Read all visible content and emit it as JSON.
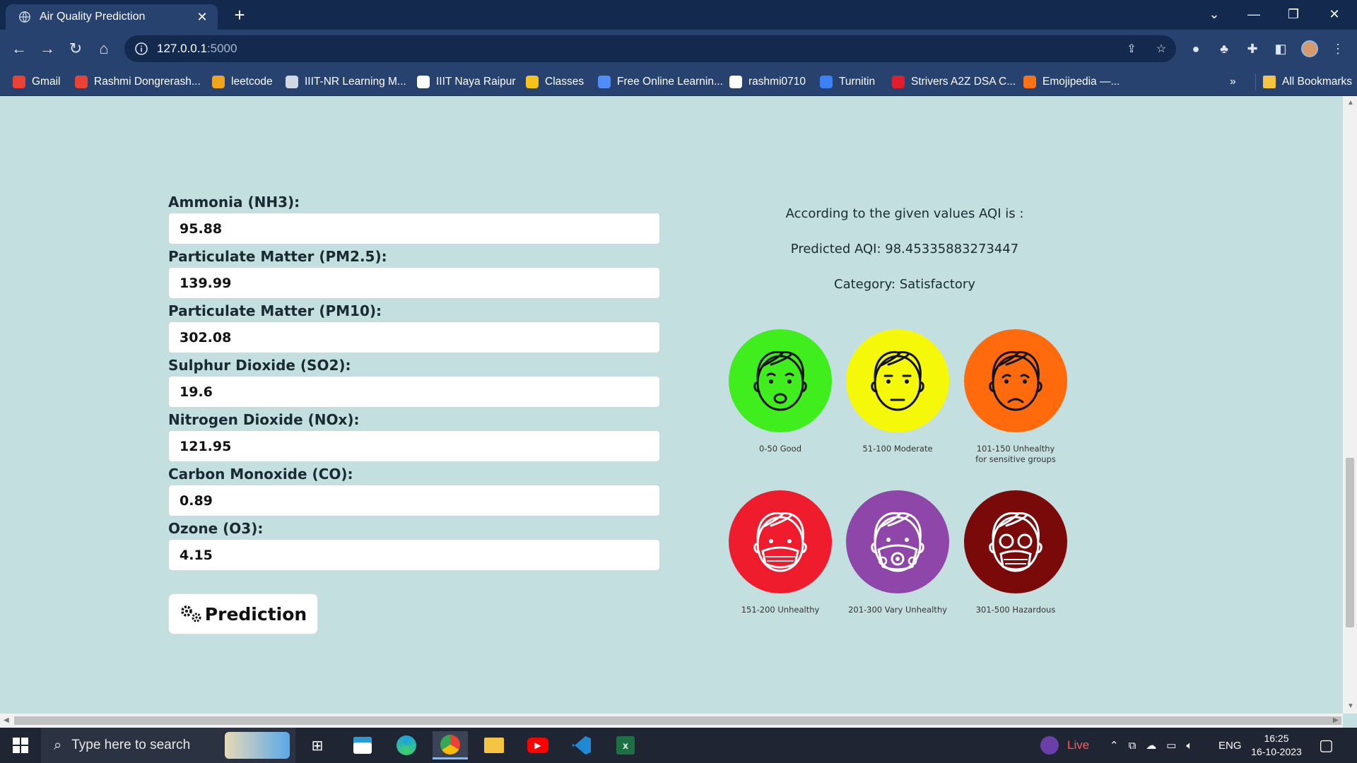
{
  "browser": {
    "tab_title": "Air Quality Prediction",
    "url_host": "127.0.0.1",
    "url_port": ":5000",
    "bookmarks": [
      {
        "label": "Gmail",
        "icon": "gmail-icon",
        "color": "#ea4335"
      },
      {
        "label": "Rashmi Dongrerash...",
        "icon": "gmail-icon",
        "color": "#ea4335"
      },
      {
        "label": "leetcode",
        "icon": "leetcode-icon",
        "color": "#f0a31c"
      },
      {
        "label": "IIIT-NR Learning M...",
        "icon": "moodle-icon",
        "color": "#cfd8e3"
      },
      {
        "label": "IIIT Naya Raipur",
        "icon": "globe-icon",
        "color": "#ffffff"
      },
      {
        "label": "Classes",
        "icon": "classroom-icon",
        "color": "#f7c21b"
      },
      {
        "label": "Free Online Learnin...",
        "icon": "coursera-icon",
        "color": "#4f8ef7"
      },
      {
        "label": "rashmi0710",
        "icon": "github-icon",
        "color": "#ffffff"
      },
      {
        "label": "Turnitin",
        "icon": "turnitin-icon",
        "color": "#3b82f6"
      },
      {
        "label": "Strivers A2Z DSA C...",
        "icon": "tuf-icon",
        "color": "#e11d2e"
      },
      {
        "label": "Emojipedia —...",
        "icon": "emojipedia-icon",
        "color": "#f97316"
      }
    ],
    "more_bookmarks": "»",
    "all_bookmarks": "All Bookmarks"
  },
  "form": {
    "fields": [
      {
        "label": "Ammonia (NH3):",
        "value": "95.88"
      },
      {
        "label": "Particulate Matter (PM2.5):",
        "value": "139.99"
      },
      {
        "label": "Particulate Matter (PM10):",
        "value": "302.08"
      },
      {
        "label": "Sulphur Dioxide (SO2):",
        "value": "19.6"
      },
      {
        "label": "Nitrogen Dioxide (NOx):",
        "value": "121.95"
      },
      {
        "label": "Carbon Monoxide (CO):",
        "value": "0.89"
      },
      {
        "label": "Ozone (O3):",
        "value": "4.15"
      }
    ],
    "submit_label": "Prediction"
  },
  "result": {
    "intro": "According to the given values AQI is :",
    "predicted": "Predicted AQI: 98.45335883273447",
    "category": "Category: Satisfactory"
  },
  "aqi_scale": [
    {
      "caption": "0-50 Good",
      "color": "#3fee1c",
      "icon": "smiling-face-icon"
    },
    {
      "caption": "51-100 Moderate",
      "color": "#f6f80a",
      "icon": "neutral-face-icon"
    },
    {
      "caption": "101-150 Unhealthy\nfor sensitive groups",
      "color": "#ff6a0d",
      "icon": "sad-face-icon"
    },
    {
      "caption": "151-200 Unhealthy",
      "color": "#ee1c2c",
      "icon": "mask-face-icon"
    },
    {
      "caption": "201-300 Vary Unhealthy",
      "color": "#8e47a8",
      "icon": "respirator-face-icon"
    },
    {
      "caption": "301-500 Hazardous",
      "color": "#7a0a0a",
      "icon": "gas-mask-face-icon"
    }
  ],
  "taskbar": {
    "search_placeholder": "Type here to search",
    "live_label": "Live",
    "language": "ENG",
    "time": "16:25",
    "date": "16-10-2023"
  }
}
